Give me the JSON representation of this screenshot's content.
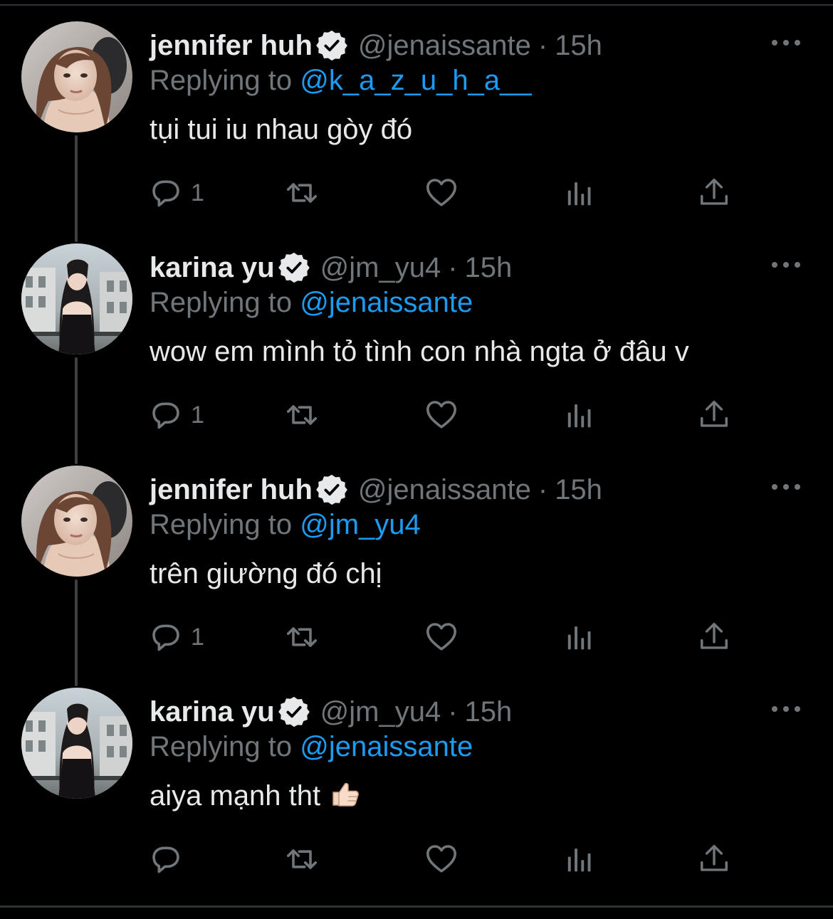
{
  "colors": {
    "background": "#000000",
    "text": "#e7e9ea",
    "muted": "#71767b",
    "mention": "#1d9bf0",
    "thread_line": "#3e4144"
  },
  "tweets": [
    {
      "author": "jennifer huh",
      "handle": "@jenaissante",
      "separator": "·",
      "time": "15h",
      "replying_prefix": "Replying to",
      "replying_to": "@k_a_z_u_h_a__",
      "text": "tụi tui iu nhau gòy đó",
      "reply_count": "1",
      "avatar_icon": "avatar-jennifer-icon"
    },
    {
      "author": "karina yu",
      "handle": "@jm_yu4",
      "separator": "·",
      "time": "15h",
      "replying_prefix": "Replying to",
      "replying_to": "@jenaissante",
      "text": "wow em mình tỏ tình con nhà ngta ở đâu v",
      "reply_count": "1",
      "avatar_icon": "avatar-karina-icon"
    },
    {
      "author": "jennifer huh",
      "handle": "@jenaissante",
      "separator": "·",
      "time": "15h",
      "replying_prefix": "Replying to",
      "replying_to": "@jm_yu4",
      "text": "trên giường đó chị",
      "reply_count": "1",
      "avatar_icon": "avatar-jennifer-icon"
    },
    {
      "author": "karina yu",
      "handle": "@jm_yu4",
      "separator": "·",
      "time": "15h",
      "replying_prefix": "Replying to",
      "replying_to": "@jenaissante",
      "text": "aiya mạnh tht",
      "reply_count": "",
      "avatar_icon": "avatar-karina-icon",
      "trailing_emoji": "thumbs-up-icon"
    }
  ]
}
